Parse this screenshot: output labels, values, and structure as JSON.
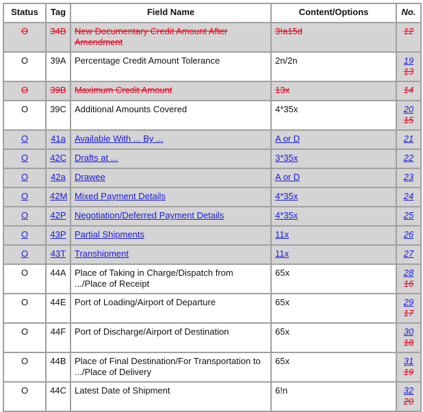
{
  "headers": [
    "Status",
    "Tag",
    "Field Name",
    "Content/Options",
    "No."
  ],
  "colors": {
    "deleted": "#e8001c",
    "link": "#1a1adc",
    "shaded": "#d4d4d4"
  },
  "rows": [
    {
      "type": "deleted",
      "status": "O",
      "tag": "34B",
      "field": "New Documentary Credit Amount After Amendment",
      "content": "3!a15d",
      "no_old": "12"
    },
    {
      "type": "normal",
      "status": "O",
      "tag": "39A",
      "field": "Percentage Credit Amount Tolerance",
      "content": "2n/2n",
      "no_new": "19",
      "no_old": "13"
    },
    {
      "type": "deleted",
      "status": "O",
      "tag": "39B",
      "field": "Maximum Credit Amount",
      "content": "13x",
      "no_old": "14"
    },
    {
      "type": "normal",
      "status": "O",
      "tag": "39C",
      "field": "Additional Amounts Covered",
      "content": "4*35x",
      "no_new": "20",
      "no_old": "15"
    },
    {
      "type": "link",
      "status": "O",
      "tag": "41a",
      "field": "Available With ... By ...",
      "content": "A or D",
      "no_new": "21"
    },
    {
      "type": "link",
      "status": "O",
      "tag": "42C",
      "field": "Drafts at ...",
      "content": "3*35x",
      "no_new": "22"
    },
    {
      "type": "link",
      "status": "O",
      "tag": "42a",
      "field": "Drawee",
      "content": "A or D",
      "no_new": "23"
    },
    {
      "type": "link",
      "status": "O",
      "tag": "42M",
      "field": "Mixed Payment Details",
      "content": "4*35x",
      "no_new": "24"
    },
    {
      "type": "link",
      "status": "O",
      "tag": "42P",
      "field": "Negotiation/Deferred Payment Details",
      "content": "4*35x",
      "no_new": "25"
    },
    {
      "type": "link",
      "status": "O",
      "tag": "43P",
      "field": "Partial Shipments",
      "content": "11x",
      "no_new": "26"
    },
    {
      "type": "link",
      "status": "O",
      "tag": "43T",
      "field": "Transhipment",
      "content": "11x",
      "no_new": "27"
    },
    {
      "type": "normal",
      "status": "O",
      "tag": "44A",
      "field": "Place of Taking in Charge/Dispatch from .../Place of Receipt",
      "content": "65x",
      "no_new": "28",
      "no_old": "16"
    },
    {
      "type": "normal",
      "status": "O",
      "tag": "44E",
      "field": "Port of Loading/Airport of Departure",
      "content": "65x",
      "no_new": "29",
      "no_old": "17"
    },
    {
      "type": "normal",
      "status": "O",
      "tag": "44F",
      "field": "Port of Discharge/Airport of Destination",
      "content": "65x",
      "no_new": "30",
      "no_old": "18"
    },
    {
      "type": "normal",
      "status": "O",
      "tag": "44B",
      "field": "Place of Final Destination/For Transportation to .../Place of Delivery",
      "content": "65x",
      "no_new": "31",
      "no_old": "19"
    },
    {
      "type": "normal",
      "status": "O",
      "tag": "44C",
      "field": "Latest Date of Shipment",
      "content": "6!n",
      "no_new": "32",
      "no_old": "20"
    }
  ]
}
